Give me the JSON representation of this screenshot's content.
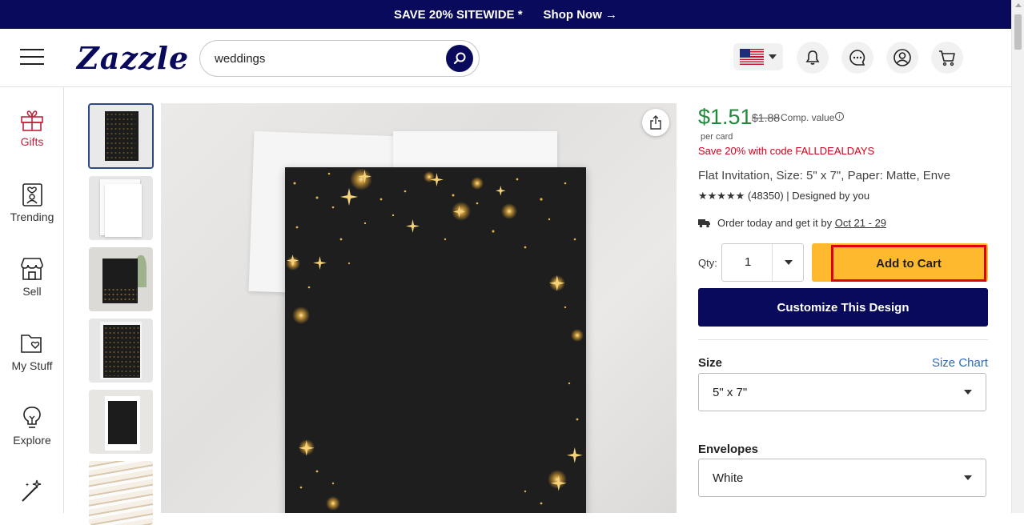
{
  "promo": {
    "text": "SAVE 20% SITEWIDE *",
    "link": "Shop Now →"
  },
  "header": {
    "logo": "Zazzle",
    "search_value": "weddings",
    "icons": [
      "search-icon",
      "us-flag-icon",
      "bell-icon",
      "chat-icon",
      "account-icon",
      "cart-icon"
    ]
  },
  "nav": {
    "items": [
      {
        "label": "Gifts",
        "icon": "gift-icon"
      },
      {
        "label": "Trending",
        "icon": "trending-icon"
      },
      {
        "label": "Sell",
        "icon": "store-icon"
      },
      {
        "label": "My Stuff",
        "icon": "folder-icon"
      },
      {
        "label": "Explore",
        "icon": "lightbulb-icon"
      },
      {
        "label": "",
        "icon": "magic-wand-icon"
      }
    ]
  },
  "product": {
    "price": "$1.51",
    "old_price": "$1.88",
    "comp_value": "Comp. value",
    "per_card": "per card",
    "promo_code": "Save 20% with code FALLDEALDAYS",
    "title": "Flat Invitation, Size: 5\" x 7\", Paper: Matte, Enve",
    "rating": "★★★★★ (48350) | Designed by you",
    "delivery_prefix": "Order today and get it by",
    "delivery_date": "Oct 21 - 29",
    "qty_label": "Qty:",
    "qty_value": "1",
    "add_to_cart": "Add to Cart",
    "customize": "Customize This Design",
    "size_label": "Size",
    "size_chart": "Size Chart",
    "size_value": "5\" x 7\"",
    "envelopes_label": "Envelopes",
    "envelopes_value": "White"
  },
  "colors": {
    "navy": "#0a0a5c",
    "price_green": "#1f8a3b",
    "promo_red": "#d0021b",
    "cart_yellow": "#ffb92e",
    "highlight": "#e0000f"
  }
}
